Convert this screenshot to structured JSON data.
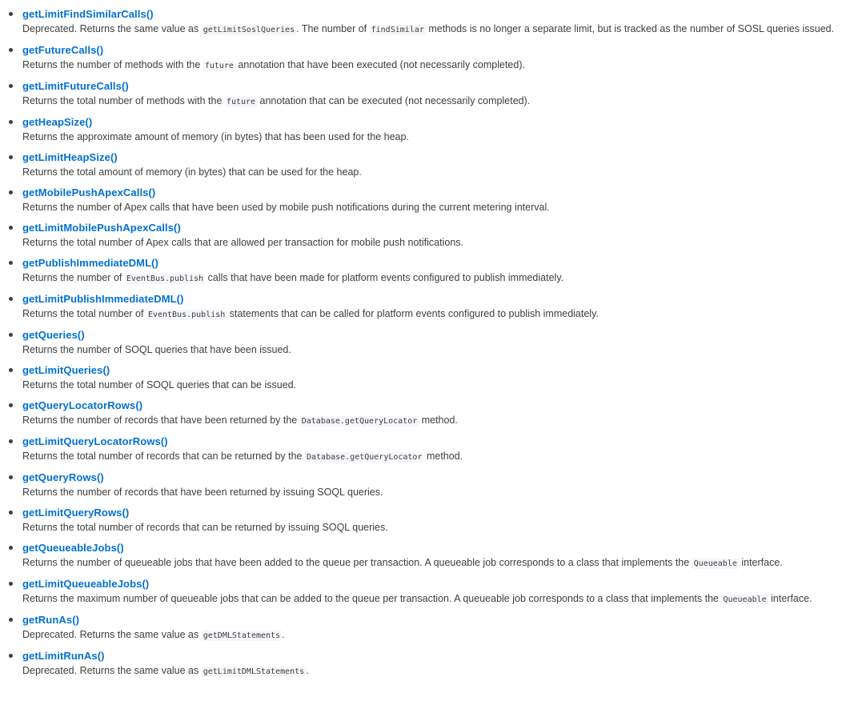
{
  "methods": [
    {
      "name": "getLimitFindSimilarCalls()",
      "desc": [
        {
          "t": "text",
          "v": "Deprecated. Returns the same value as "
        },
        {
          "t": "code",
          "v": "getLimitSoslQueries"
        },
        {
          "t": "text",
          "v": ". The number of "
        },
        {
          "t": "code",
          "v": "findSimilar"
        },
        {
          "t": "text",
          "v": " methods is no longer a separate limit, but is tracked as the number of SOSL queries issued."
        }
      ]
    },
    {
      "name": "getFutureCalls()",
      "desc": [
        {
          "t": "text",
          "v": "Returns the number of methods with the "
        },
        {
          "t": "code",
          "v": "future"
        },
        {
          "t": "text",
          "v": " annotation that have been executed (not necessarily completed)."
        }
      ]
    },
    {
      "name": "getLimitFutureCalls()",
      "desc": [
        {
          "t": "text",
          "v": "Returns the total number of methods with the "
        },
        {
          "t": "code",
          "v": "future"
        },
        {
          "t": "text",
          "v": " annotation that can be executed (not necessarily completed)."
        }
      ]
    },
    {
      "name": "getHeapSize()",
      "desc": [
        {
          "t": "text",
          "v": "Returns the approximate amount of memory (in bytes) that has been used for the heap."
        }
      ]
    },
    {
      "name": "getLimitHeapSize()",
      "desc": [
        {
          "t": "text",
          "v": "Returns the total amount of memory (in bytes) that can be used for the heap."
        }
      ]
    },
    {
      "name": "getMobilePushApexCalls()",
      "desc": [
        {
          "t": "text",
          "v": "Returns the number of Apex calls that have been used by mobile push notifications during the current metering interval."
        }
      ]
    },
    {
      "name": "getLimitMobilePushApexCalls()",
      "desc": [
        {
          "t": "text",
          "v": "Returns the total number of Apex calls that are allowed per transaction for mobile push notifications."
        }
      ]
    },
    {
      "name": "getPublishImmediateDML()",
      "desc": [
        {
          "t": "text",
          "v": "Returns the number of "
        },
        {
          "t": "code",
          "v": "EventBus.publish"
        },
        {
          "t": "text",
          "v": " calls that have been made for platform events configured to publish immediately."
        }
      ]
    },
    {
      "name": "getLimitPublishImmediateDML()",
      "desc": [
        {
          "t": "text",
          "v": "Returns the total number of "
        },
        {
          "t": "code",
          "v": "EventBus.publish"
        },
        {
          "t": "text",
          "v": " statements that can be called for platform events configured to publish immediately."
        }
      ]
    },
    {
      "name": "getQueries()",
      "desc": [
        {
          "t": "text",
          "v": "Returns the number of SOQL queries that have been issued."
        }
      ]
    },
    {
      "name": "getLimitQueries()",
      "desc": [
        {
          "t": "text",
          "v": "Returns the total number of SOQL queries that can be issued."
        }
      ]
    },
    {
      "name": "getQueryLocatorRows()",
      "desc": [
        {
          "t": "text",
          "v": "Returns the number of records that have been returned by the "
        },
        {
          "t": "code",
          "v": "Database.getQueryLocator"
        },
        {
          "t": "text",
          "v": " method."
        }
      ]
    },
    {
      "name": "getLimitQueryLocatorRows()",
      "desc": [
        {
          "t": "text",
          "v": "Returns the total number of records that can be returned by the "
        },
        {
          "t": "code",
          "v": "Database.getQueryLocator"
        },
        {
          "t": "text",
          "v": " method."
        }
      ]
    },
    {
      "name": "getQueryRows()",
      "desc": [
        {
          "t": "text",
          "v": "Returns the number of records that have been returned by issuing SOQL queries."
        }
      ]
    },
    {
      "name": "getLimitQueryRows()",
      "desc": [
        {
          "t": "text",
          "v": "Returns the total number of records that can be returned by issuing SOQL queries."
        }
      ]
    },
    {
      "name": "getQueueableJobs()",
      "desc": [
        {
          "t": "text",
          "v": "Returns the number of queueable jobs that have been added to the queue per transaction. A queueable job corresponds to a class that implements the "
        },
        {
          "t": "code",
          "v": "Queueable"
        },
        {
          "t": "text",
          "v": " interface."
        }
      ]
    },
    {
      "name": "getLimitQueueableJobs()",
      "desc": [
        {
          "t": "text",
          "v": "Returns the maximum number of queueable jobs that can be added to the queue per transaction. A queueable job corresponds to a class that implements the "
        },
        {
          "t": "code",
          "v": "Queueable"
        },
        {
          "t": "text",
          "v": " interface."
        }
      ]
    },
    {
      "name": "getRunAs()",
      "desc": [
        {
          "t": "text",
          "v": "Deprecated. Returns the same value as "
        },
        {
          "t": "code",
          "v": "getDMLStatements"
        },
        {
          "t": "text",
          "v": "."
        }
      ]
    },
    {
      "name": "getLimitRunAs()",
      "desc": [
        {
          "t": "text",
          "v": "Deprecated. Returns the same value as "
        },
        {
          "t": "code",
          "v": "getLimitDMLStatements"
        },
        {
          "t": "text",
          "v": "."
        }
      ]
    }
  ]
}
